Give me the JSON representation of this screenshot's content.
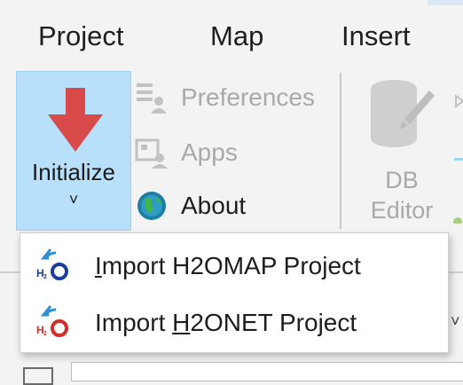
{
  "menu": {
    "tabs": [
      "Project",
      "Map",
      "Insert"
    ]
  },
  "ribbon": {
    "initialize": {
      "label": "Initialize",
      "chevron": "˅",
      "icon": "down-arrow-icon",
      "color": "#d94b4b"
    },
    "commands": [
      {
        "label": "Preferences",
        "icon": "preferences-icon",
        "enabled": false
      },
      {
        "label": "Apps",
        "icon": "apps-icon",
        "enabled": false
      },
      {
        "label": "About",
        "icon": "globe-icon",
        "enabled": true
      }
    ],
    "db_editor": {
      "label_line1": "DB",
      "label_line2": "Editor",
      "icon": "db-editor-icon",
      "enabled": false
    }
  },
  "dropdown": {
    "items": [
      {
        "pre": "",
        "underline": "I",
        "post": "mport H2OMAP Project",
        "icon": "h2omap-import-icon"
      },
      {
        "pre": "Import ",
        "underline": "H",
        "post": "2ONET Project",
        "icon": "h2onet-import-icon"
      }
    ]
  },
  "colors": {
    "accent": "#b9e0fb",
    "disabled_text": "#a9a9a9",
    "background": "#f3f3f3"
  }
}
